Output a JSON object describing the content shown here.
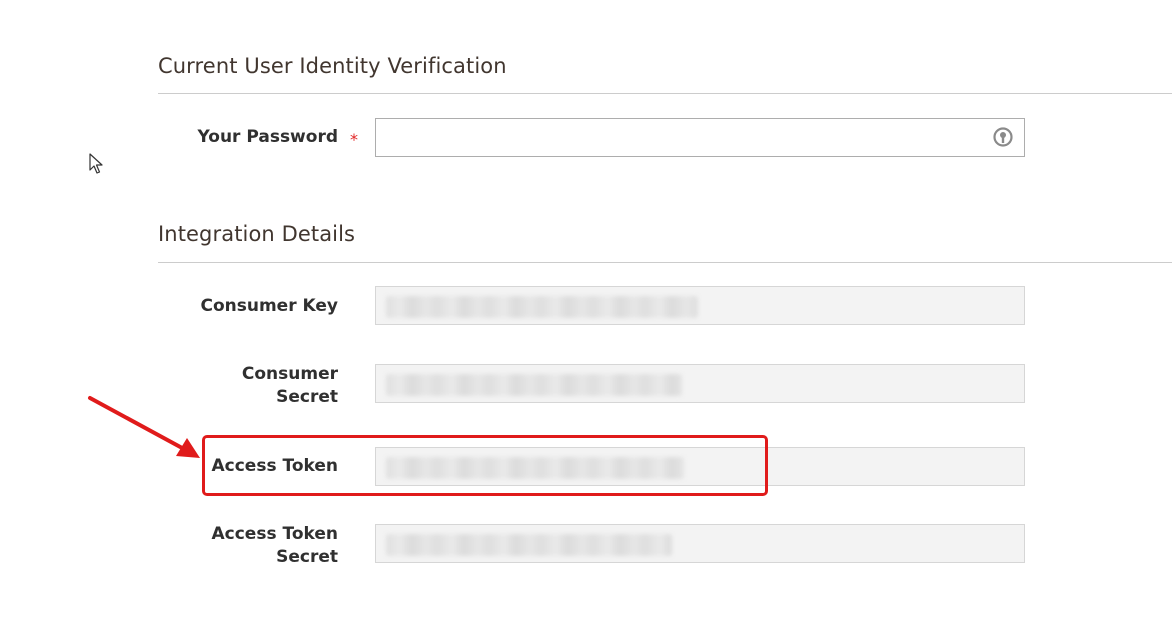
{
  "sections": {
    "identity": {
      "title": "Current User Identity Verification",
      "password": {
        "label": "Your Password",
        "required_mark": "*",
        "value": ""
      }
    },
    "integration": {
      "title": "Integration Details",
      "consumer_key": {
        "label": "Consumer Key"
      },
      "consumer_secret": {
        "label_line1": "Consumer",
        "label_line2": "Secret"
      },
      "access_token": {
        "label": "Access Token"
      },
      "access_token_secret": {
        "label_line1": "Access Token",
        "label_line2": "Secret"
      }
    }
  },
  "annotation": {
    "color": "#e01b1b"
  },
  "icons": {
    "password_manager": "password-manager-icon",
    "cursor": "mouse-pointer-icon"
  }
}
